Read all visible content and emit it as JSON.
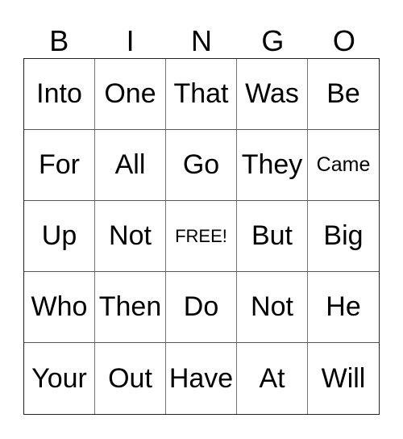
{
  "header": [
    "B",
    "I",
    "N",
    "G",
    "O"
  ],
  "rows": [
    [
      "Into",
      "One",
      "That",
      "Was",
      "Be"
    ],
    [
      "For",
      "All",
      "Go",
      "They",
      "Came"
    ],
    [
      "Up",
      "Not",
      "FREE!",
      "But",
      "Big"
    ],
    [
      "Who",
      "Then",
      "Do",
      "Not",
      "He"
    ],
    [
      "Your",
      "Out",
      "Have",
      "At",
      "Will"
    ]
  ]
}
